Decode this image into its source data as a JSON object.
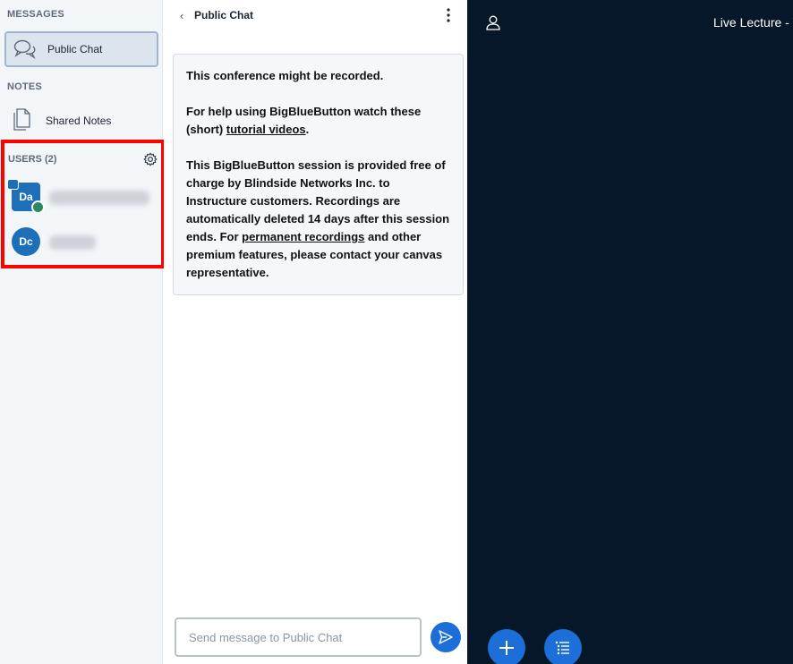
{
  "sidebar": {
    "messages_title": "MESSAGES",
    "public_chat_label": "Public Chat",
    "notes_title": "NOTES",
    "shared_notes_label": "Shared Notes",
    "users_title": "USERS (2)",
    "users": [
      {
        "initials": "Da",
        "shape": "square",
        "presenter": true,
        "moderator": true
      },
      {
        "initials": "Dc",
        "shape": "round",
        "presenter": false,
        "moderator": false
      }
    ]
  },
  "chat": {
    "title": "Public Chat",
    "back_glyph": "‹",
    "welcome": {
      "line1": "This conference might be recorded.",
      "help_prefix": "For help using BigBlueButton watch these (short) ",
      "help_link": "tutorial videos",
      "help_suffix": ".",
      "notice_prefix": "This BigBlueButton session is provided free of charge by Blindside Networks Inc. to Instructure customers. ",
      "notice_bold": "Recordings are automatically deleted 14 days after this session ends.",
      "notice_mid": " For ",
      "notice_link": "permanent recordings",
      "notice_suffix": " and other premium features, please contact your canvas representative."
    },
    "input_placeholder": "Send message to Public Chat"
  },
  "presentation": {
    "meeting_title": "Live Lecture - W",
    "accent_color": "#1c6fd8",
    "background_color": "#06172a"
  }
}
